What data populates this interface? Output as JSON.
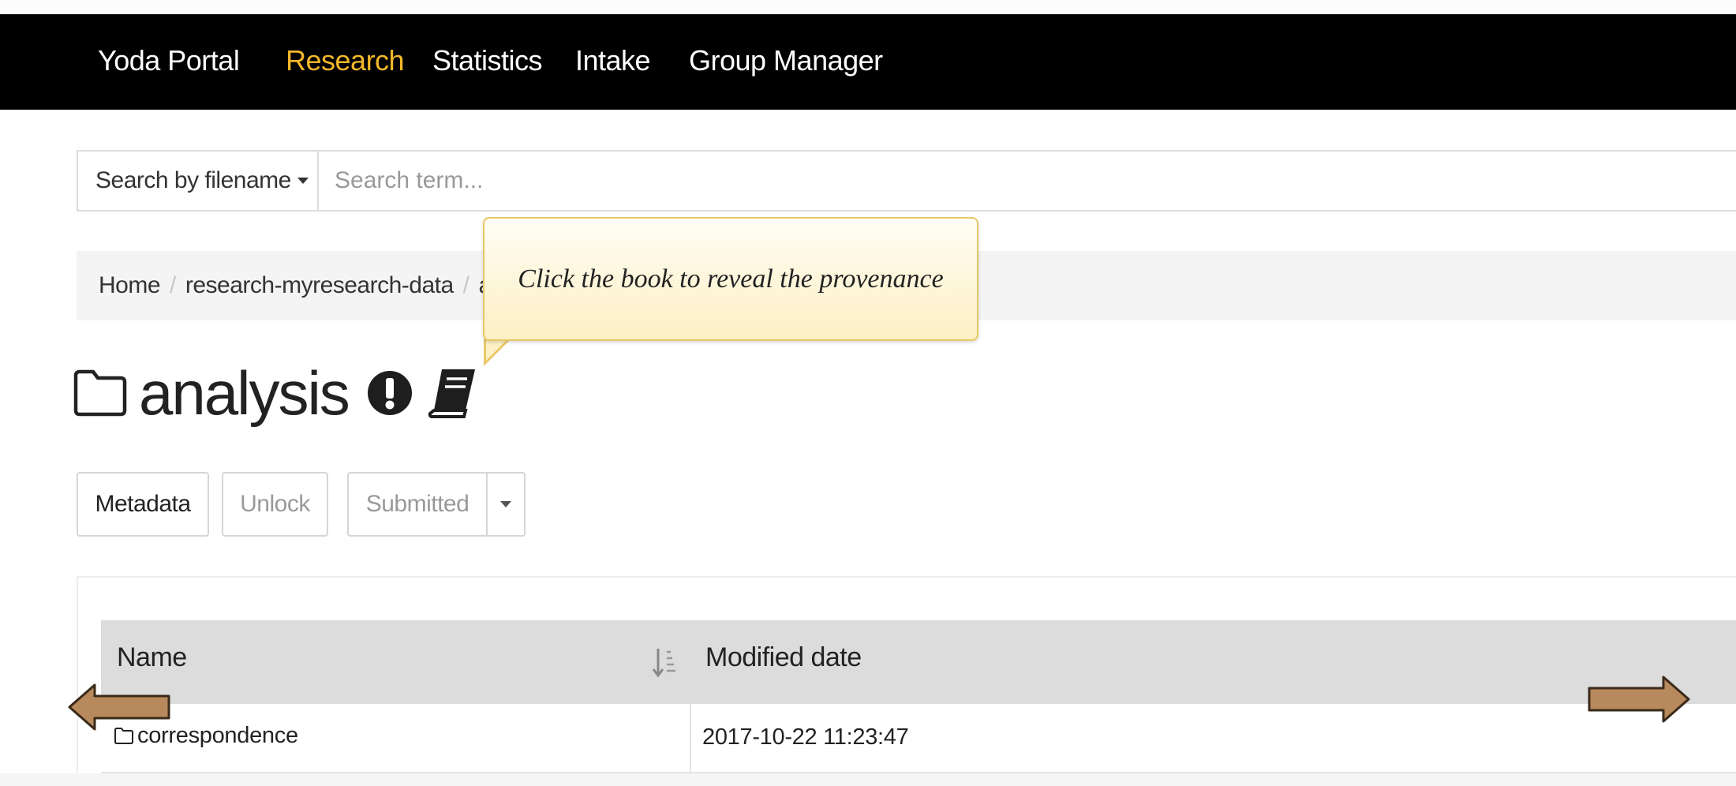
{
  "navbar": {
    "brand": "Yoda Portal",
    "items": [
      {
        "label": "Research",
        "active": true
      },
      {
        "label": "Statistics",
        "active": false
      },
      {
        "label": "Intake",
        "active": false
      },
      {
        "label": "Group Manager",
        "active": false
      }
    ],
    "colors": {
      "background": "#000000",
      "text": "#ffffff",
      "active": "#f2b72a"
    }
  },
  "search": {
    "mode_label": "Search by filename",
    "placeholder": "Search term..."
  },
  "breadcrumb": {
    "items": [
      "Home",
      "research-myresearch-data",
      "a"
    ]
  },
  "tooltip": {
    "text": "Click the book to reveal the provenance"
  },
  "folder": {
    "title": "analysis",
    "icons": [
      "folder-icon",
      "alert-icon",
      "book-icon"
    ]
  },
  "actions": {
    "metadata_label": "Metadata",
    "unlock_label": "Unlock",
    "submitted_label": "Submitted"
  },
  "table": {
    "columns": [
      "Name",
      "Modified date"
    ],
    "rows": [
      {
        "name": "correspondence",
        "modified": "2017-10-22 11:23:47",
        "type": "folder"
      }
    ]
  },
  "overlay": {
    "arrows": [
      "previous-arrow",
      "next-arrow"
    ],
    "arrow_color": "#b8895c"
  }
}
